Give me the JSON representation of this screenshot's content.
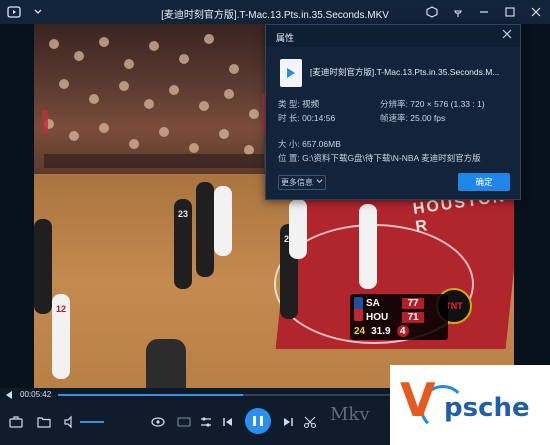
{
  "titlebar": {
    "title": "[麦迪时刻官方版].T-Mac.13.Pts.in.35.Seconds.MKV"
  },
  "dialog": {
    "title": "属性",
    "file_name": "[麦迪时刻官方版].T-Mac.13.Pts.in.35.Seconds.M...",
    "type_label": "类  型:",
    "type_value": "视频",
    "duration_label": "时  长:",
    "duration_value": "00:14:56",
    "resolution_label": "分辨率:",
    "resolution_value": "720 × 576 (1.33 : 1)",
    "framerate_label": "帧速率:",
    "framerate_value": "25.00 fps",
    "size_label": "大  小:",
    "size_value": "657.06MB",
    "location_label": "位  置:",
    "location_value": "G:\\资料下载G盘\\待下载\\N-NBA 麦迪时刻官方版",
    "more_label": "更多信息",
    "ok_label": "确定"
  },
  "scoreboard": {
    "team1": "SA",
    "score1": "77",
    "team2": "HOU",
    "score2": "71",
    "shot_clock": "24",
    "game_clock": "31.9",
    "quarter": "4",
    "network": "TNT"
  },
  "court": {
    "baseline": "HOUSTON R"
  },
  "players": {
    "p1": "23",
    "p2": "20",
    "p3": "12"
  },
  "progress": {
    "time": "00:05:42",
    "fraction": 0.38
  },
  "brand": {
    "letter": "V",
    "text": "psche"
  },
  "watermark": "Mkv",
  "colors": {
    "accent": "#2a8fef",
    "dialog_bg": "#13243a",
    "titlebar_bg": "#12243a"
  }
}
